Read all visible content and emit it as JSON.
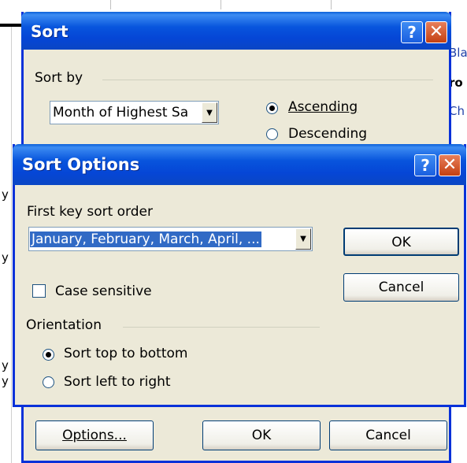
{
  "background_sheet": {
    "fragments": [
      "Bla",
      "ro",
      "Ch",
      "y",
      "y",
      "y",
      "y"
    ]
  },
  "sort_dialog": {
    "title": "Sort",
    "sort_by_label": "Sort by",
    "sort_by_value": "Month of Highest Sa",
    "ascending_label": "Ascending",
    "descending_label": "Descending",
    "options_button": "Options...",
    "ok_button": "OK",
    "cancel_button": "Cancel",
    "help_glyph": "?",
    "close_glyph": "✕"
  },
  "sort_options_dialog": {
    "title": "Sort Options",
    "first_key_label": "First key sort order",
    "first_key_value": "January, February, March, April, ...",
    "ok_button": "OK",
    "cancel_button": "Cancel",
    "case_sensitive_label": "Case sensitive",
    "case_sensitive_checked": false,
    "orientation_label": "Orientation",
    "orientation_options": [
      "Sort top to bottom",
      "Sort left to right"
    ],
    "orientation_selected": "Sort top to bottom",
    "help_glyph": "?",
    "close_glyph": "✕"
  },
  "colors": {
    "title_bar": "#0855dd",
    "dialog_face": "#ece9d8",
    "selection": "#316ac5",
    "close_button": "#c44012"
  }
}
